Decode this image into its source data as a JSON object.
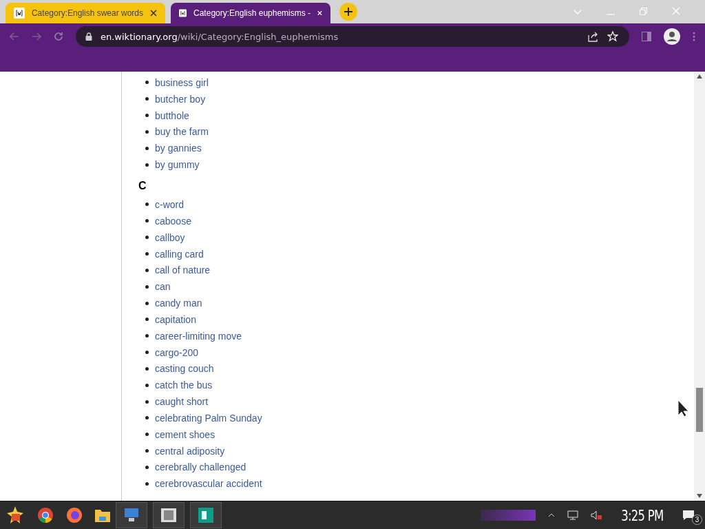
{
  "browser": {
    "tabs": [
      {
        "title": "Category:English swear words",
        "selected": false
      },
      {
        "title": "Category:English euphemisms -",
        "selected": true
      }
    ],
    "address": {
      "host": "en.wiktionary.org",
      "path": "/wiki/Category:English_euphemisms"
    }
  },
  "page": {
    "sections": [
      {
        "entries": [
          "business girl",
          "butcher boy",
          "butthole",
          "buy the farm",
          "by gannies",
          "by gummy"
        ]
      },
      {
        "heading": "C",
        "entries": [
          "c-word",
          "caboose",
          "callboy",
          "calling card",
          "call of nature",
          "can",
          "candy man",
          "capitation",
          "career-limiting move",
          "cargo-200",
          "casting couch",
          "catch the bus",
          "caught short",
          "celebrating Palm Sunday",
          "cement shoes",
          "central adiposity",
          "cerebrally challenged",
          "cerebrovascular accident"
        ]
      }
    ]
  },
  "taskbar": {
    "clock": "3:25 PM",
    "notification_count": "3"
  }
}
